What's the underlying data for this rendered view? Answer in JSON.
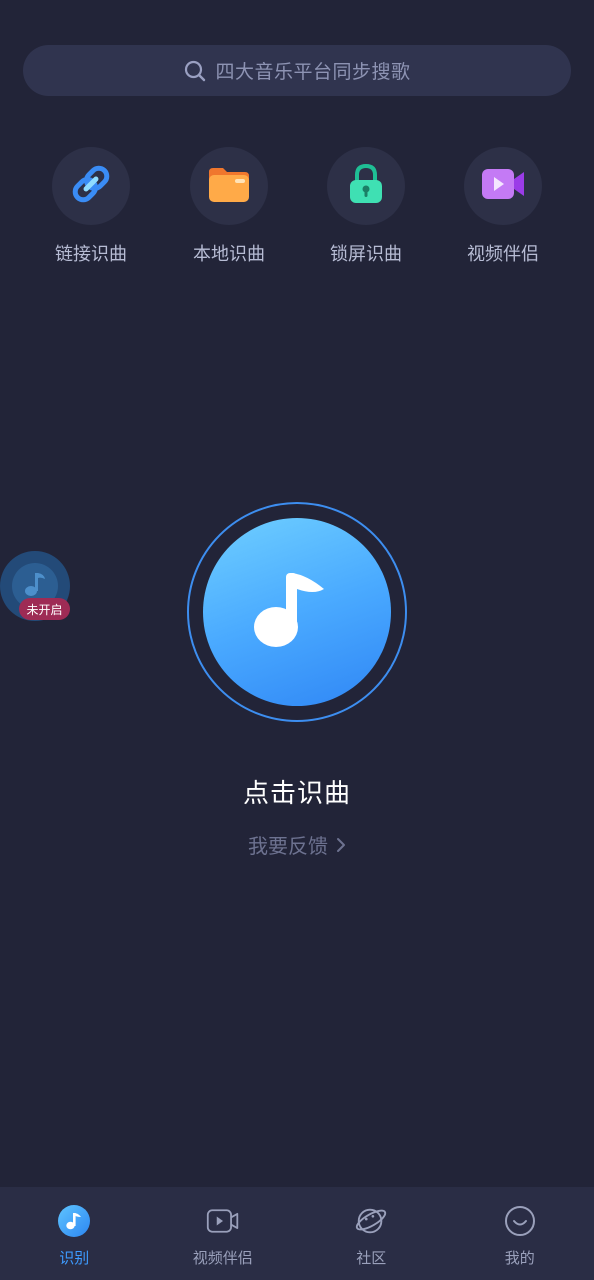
{
  "search": {
    "placeholder": "四大音乐平台同步搜歌"
  },
  "shortcuts": [
    {
      "label": "链接识曲",
      "icon": "link-icon"
    },
    {
      "label": "本地识曲",
      "icon": "folder-icon"
    },
    {
      "label": "锁屏识曲",
      "icon": "lock-icon"
    },
    {
      "label": "视频伴侣",
      "icon": "video-icon"
    }
  ],
  "recognize": {
    "title": "点击识曲",
    "feedback": "我要反馈"
  },
  "floating": {
    "badge": "未开启"
  },
  "nav": [
    {
      "label": "识别",
      "icon": "music-note-icon",
      "active": true
    },
    {
      "label": "视频伴侣",
      "icon": "video-play-icon",
      "active": false
    },
    {
      "label": "社区",
      "icon": "planet-icon",
      "active": false
    },
    {
      "label": "我的",
      "icon": "smile-face-icon",
      "active": false
    }
  ],
  "colors": {
    "background": "#222438",
    "accent": "#3e9bff",
    "badge": "#9e2b55"
  }
}
